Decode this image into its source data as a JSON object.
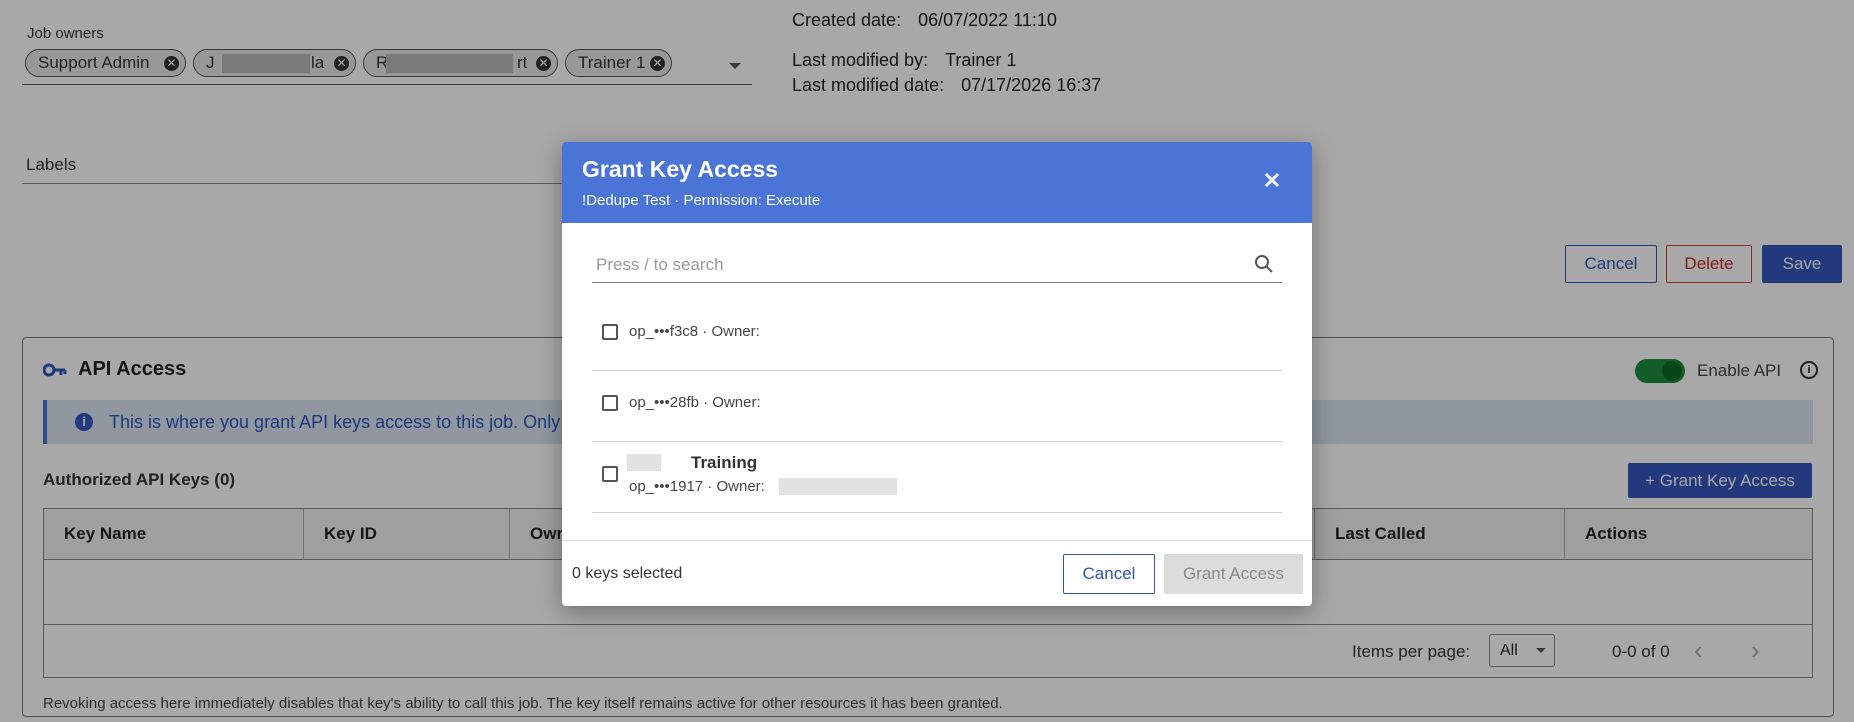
{
  "job": {
    "owners_label": "Job owners",
    "owners": [
      "Support Admin",
      "J",
      "la",
      "R",
      "rt",
      "Trainer 1"
    ],
    "labels_label": "Labels",
    "created_date_label": "Created date:",
    "created_date": "06/07/2022 11:10",
    "modified_by_label": "Last modified by:",
    "modified_by": "Trainer 1",
    "modified_date_label": "Last modified date:",
    "modified_date": "07/17/2026 16:37",
    "cancel": "Cancel",
    "delete": "Delete",
    "save": "Save"
  },
  "api": {
    "title": "API Access",
    "enable_label": "Enable API",
    "info": "This is where you grant API keys access to this job. Only",
    "authorized_label": "Authorized API Keys (0)",
    "grant_button": "+ Grant Key Access",
    "columns": [
      "Key Name",
      "Key ID",
      "Own",
      "Last Called",
      "Actions"
    ],
    "items_per_page_label": "Items per page:",
    "items_per_page_value": "All",
    "range": "0-0 of 0",
    "footer_note": "Revoking access here immediately disables that key's ability to call this job. The key itself remains active for other resources it has been granted."
  },
  "dialog": {
    "title": "Grant Key Access",
    "subtitle": "!Dedupe Test · Permission: Execute",
    "search_placeholder": "Press / to search",
    "keys": [
      {
        "text": "op_•••f3c8 · Owner:"
      },
      {
        "text": "op_•••28fb · Owner:"
      },
      {
        "name": "Training",
        "text": "op_•••1917 · Owner:"
      }
    ],
    "selected_count": "0 keys selected",
    "cancel": "Cancel",
    "grant": "Grant Access"
  },
  "colors": {
    "dialog_header": "#4a74d6",
    "primary": "#3457c0",
    "danger": "#c62828",
    "toggle": "#1e8e3e"
  }
}
